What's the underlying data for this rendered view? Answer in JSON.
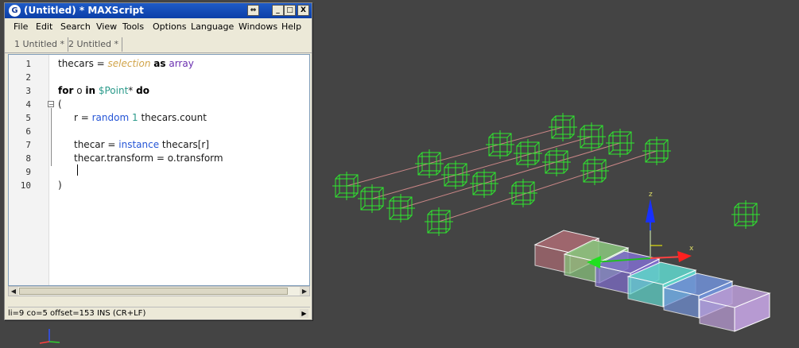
{
  "window": {
    "title": "(Untitled) * MAXScript",
    "app_icon": "3ds-max-icon",
    "buttons": {
      "pin": "⇔",
      "minimize": "_",
      "maximize": "□",
      "close": "X"
    }
  },
  "menu": [
    "File",
    "Edit",
    "Search",
    "View",
    "Tools",
    "Options",
    "Language",
    "Windows",
    "Help"
  ],
  "tabs": [
    {
      "label": "1 Untitled *",
      "active": true
    },
    {
      "label": "2 Untitled *",
      "active": false
    }
  ],
  "line_numbers": [
    "1",
    "2",
    "3",
    "4",
    "5",
    "6",
    "7",
    "8",
    "9",
    "10"
  ],
  "code": {
    "l1": {
      "a": "thecars = ",
      "b": "selection",
      "c": " ",
      "d": "as",
      "e": " array"
    },
    "l3": {
      "a": "for",
      "b": " o ",
      "c": "in",
      "d": " ",
      "e": "$Point",
      "f": "* ",
      "g": "do"
    },
    "l4": "(",
    "l5": {
      "a": "r = ",
      "b": "random",
      "c": " ",
      "d": "1",
      "e": " thecars.count"
    },
    "l7": {
      "a": "thecar = ",
      "b": "instance",
      "c": " thecars[r]"
    },
    "l8": "thecar.transform = o.transform",
    "l10": ")"
  },
  "status_text": "li=9 co=5 offset=153 INS (CR+LF)",
  "viewport": {
    "background": "#444444",
    "gizmo_labels": {
      "z": "z",
      "x": "x"
    },
    "point_color": "#2ee82e",
    "box_colors": [
      "#a86a72",
      "#88c27c",
      "#7e6cc8",
      "#5fd1c7",
      "#6f8ed1",
      "#b79ad2"
    ]
  }
}
